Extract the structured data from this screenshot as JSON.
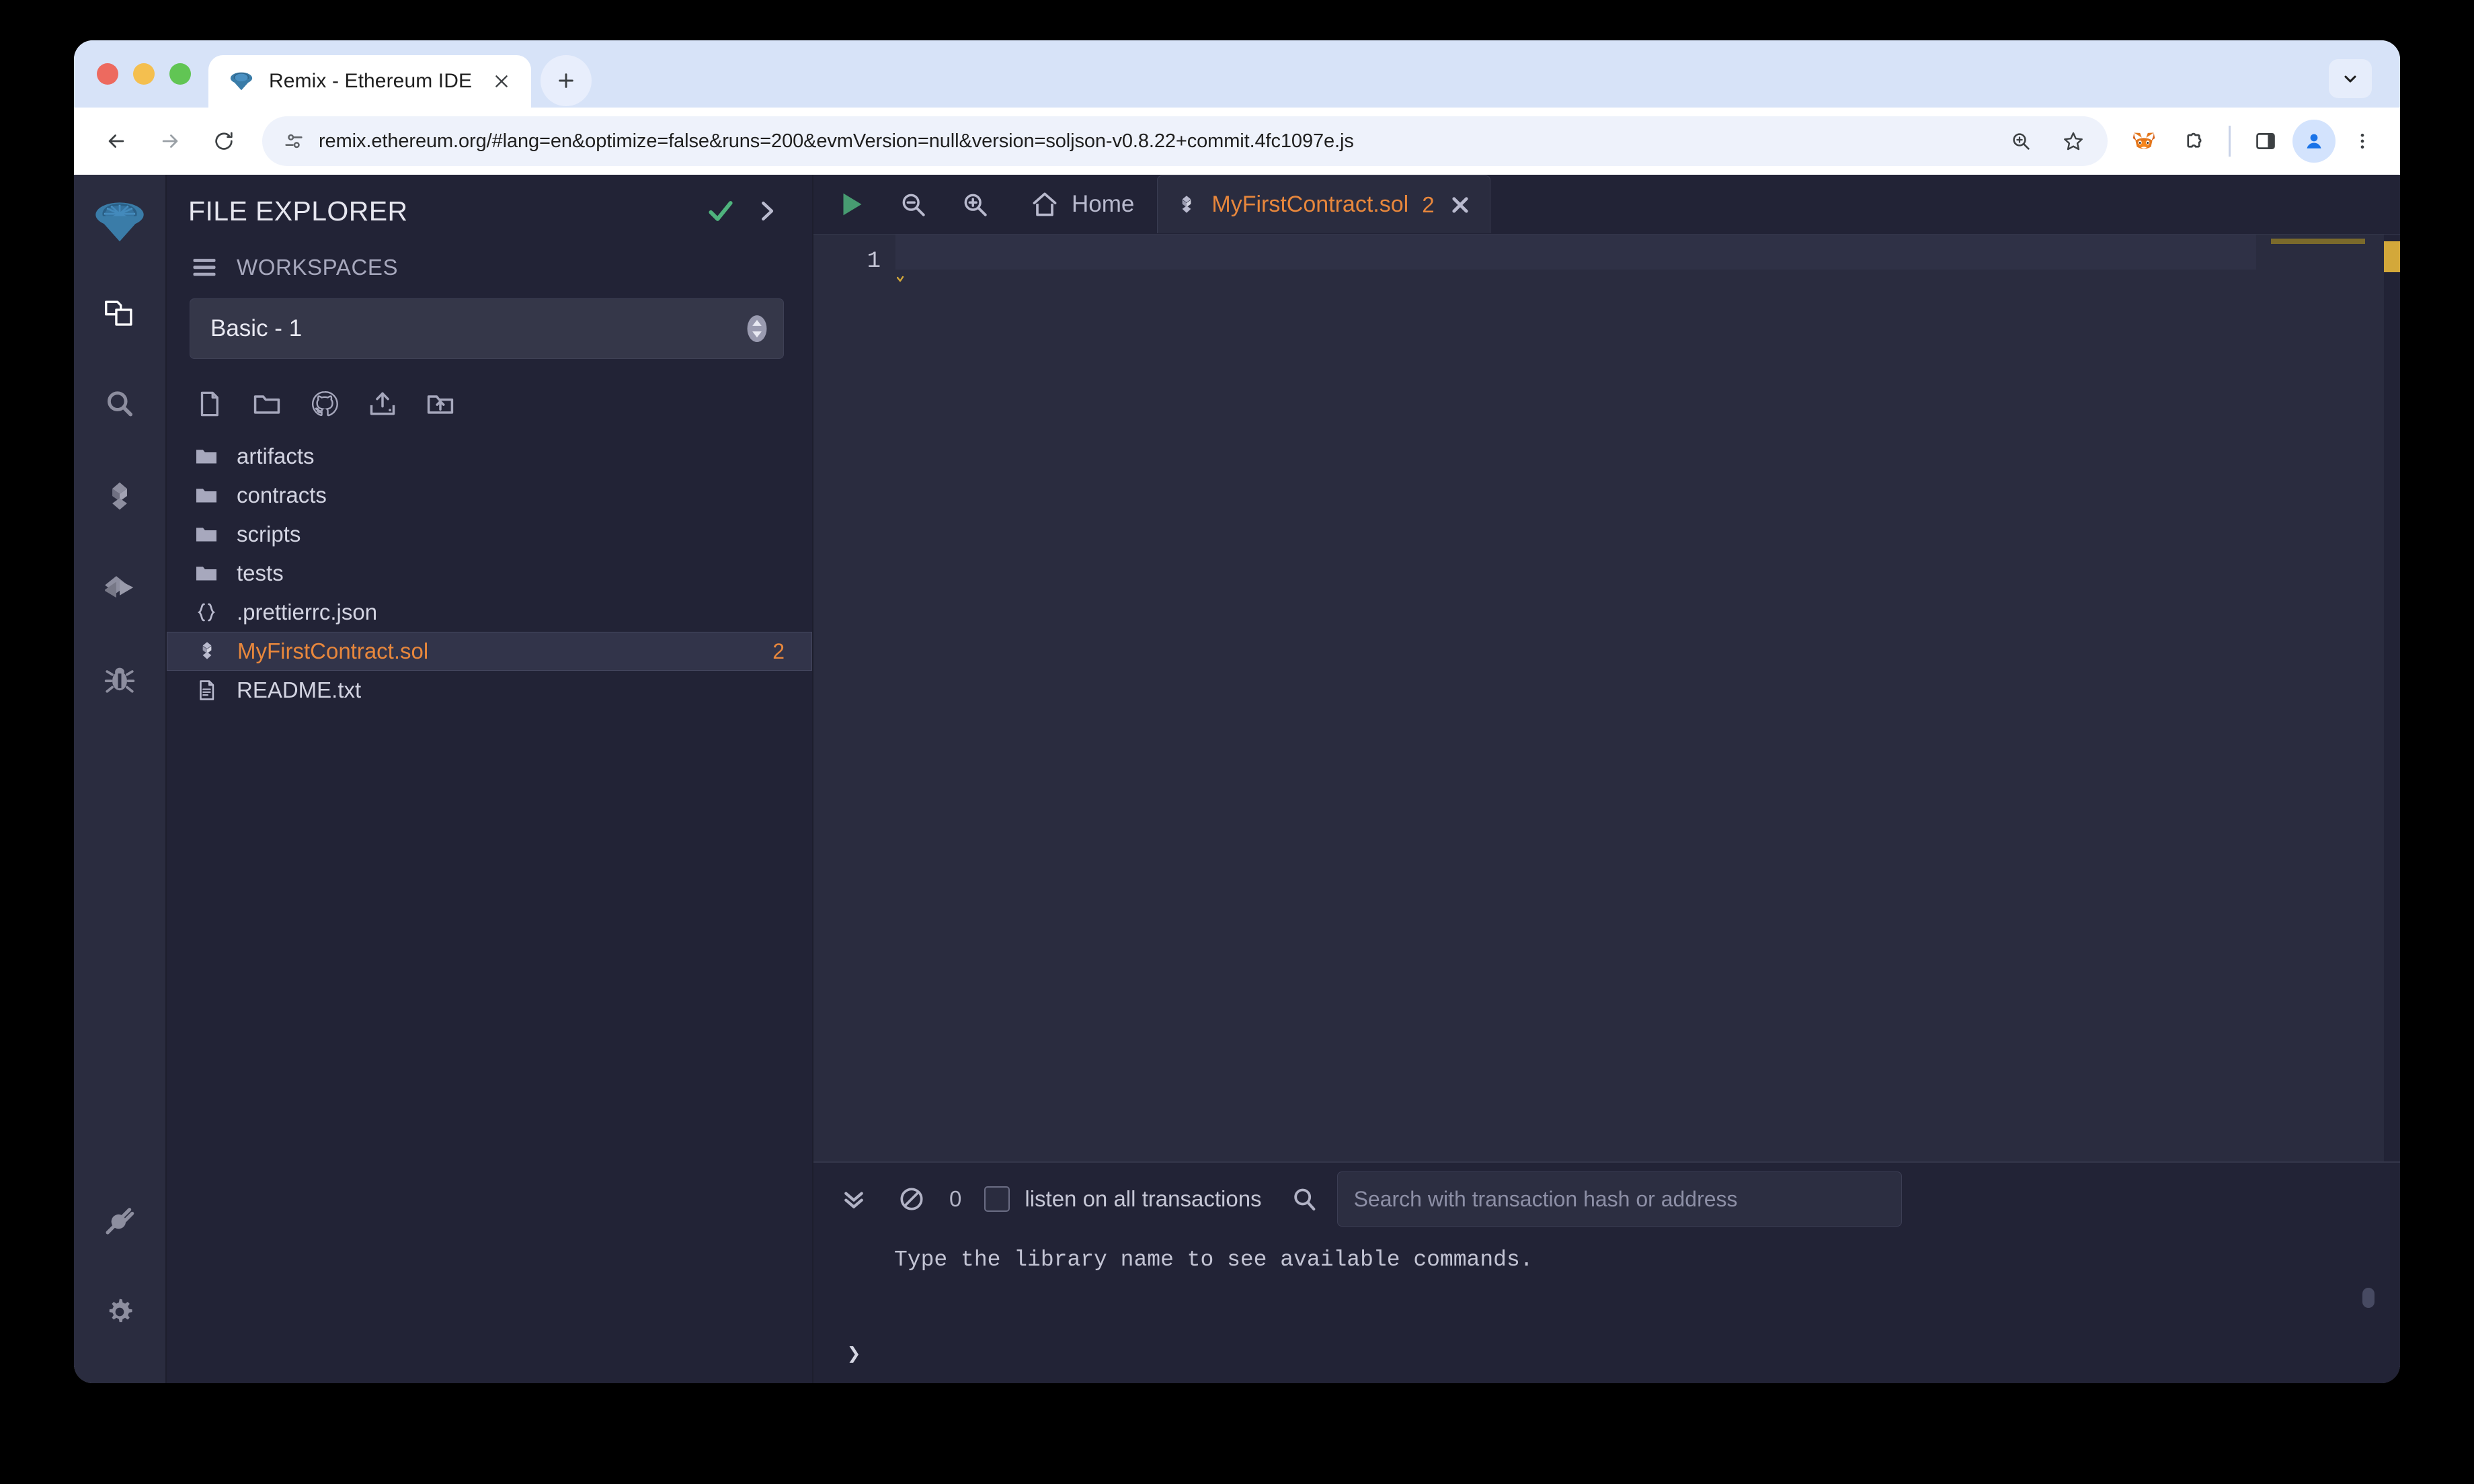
{
  "browser": {
    "tab": {
      "title": "Remix - Ethereum IDE",
      "favicon_name": "remix-logo-icon",
      "close_label": "×"
    },
    "new_tab_label": "+",
    "tab_list_label": "⌄",
    "nav": {
      "back_label": "←",
      "forward_label": "→",
      "reload_label": "↻"
    },
    "omnibox": {
      "url": "remix.ethereum.org/#lang=en&optimize=false&runs=200&evmVersion=null&version=soljson-v0.8.22+commit.4fc1097e.js",
      "site_info_icon": "page-settings-icon",
      "zoom_icon": "zoom-in-icon",
      "bookmark_icon": "star-icon"
    },
    "toolbar_icons": [
      {
        "name": "metamask-extension-icon",
        "label": "MetaMask"
      },
      {
        "name": "extensions-puzzle-icon",
        "label": "Extensions"
      },
      {
        "name": "side-panel-icon",
        "label": "Side panel"
      },
      {
        "name": "profile-avatar-icon",
        "label": "Profile"
      },
      {
        "name": "chrome-menu-icon",
        "label": "Customize and control"
      }
    ]
  },
  "ide": {
    "activity_bar": {
      "logo_name": "remix-logo-icon",
      "items": [
        {
          "name": "file-explorer",
          "icon": "files-icon",
          "active": true
        },
        {
          "name": "search",
          "icon": "search-icon",
          "active": false
        },
        {
          "name": "solidity-compiler",
          "icon": "solidity-icon",
          "active": false
        },
        {
          "name": "deploy-run",
          "icon": "deploy-arrow-icon",
          "active": false
        },
        {
          "name": "debugger",
          "icon": "bug-icon",
          "active": false
        }
      ],
      "bottom_items": [
        {
          "name": "plugin-manager",
          "icon": "plug-icon"
        },
        {
          "name": "settings",
          "icon": "gear-icon"
        }
      ]
    },
    "explorer": {
      "title": "FILE EXPLORER",
      "header_icons": [
        {
          "name": "checkmark-icon",
          "color": "#4fb37d"
        },
        {
          "name": "chevron-right-icon",
          "color": "#b9bace"
        }
      ],
      "workspaces_label": "WORKSPACES",
      "hamburger_icon": "hamburger-menu-icon",
      "workspace_value": "Basic - 1",
      "actions": [
        {
          "name": "create-new-file",
          "icon": "new-file-icon"
        },
        {
          "name": "create-new-folder",
          "icon": "new-folder-icon"
        },
        {
          "name": "clone-git-repository",
          "icon": "github-icon"
        },
        {
          "name": "publish-to-gist",
          "icon": "upload-gist-icon"
        },
        {
          "name": "upload-folder",
          "icon": "upload-folder-icon"
        }
      ],
      "tree": [
        {
          "label": "artifacts",
          "icon": "folder-icon",
          "type": "folder",
          "selected": false,
          "badge": ""
        },
        {
          "label": "contracts",
          "icon": "folder-icon",
          "type": "folder",
          "selected": false,
          "badge": ""
        },
        {
          "label": "scripts",
          "icon": "folder-icon",
          "type": "folder",
          "selected": false,
          "badge": ""
        },
        {
          "label": "tests",
          "icon": "folder-icon",
          "type": "folder",
          "selected": false,
          "badge": ""
        },
        {
          "label": ".prettierrc.json",
          "icon": "json-braces-icon",
          "type": "file",
          "selected": false,
          "badge": ""
        },
        {
          "label": "MyFirstContract.sol",
          "icon": "solidity-file-icon",
          "type": "file",
          "selected": true,
          "badge": "2"
        },
        {
          "label": "README.txt",
          "icon": "text-file-icon",
          "type": "file",
          "selected": false,
          "badge": ""
        }
      ]
    },
    "editor": {
      "toolbar": {
        "run_icon": "play-run-icon",
        "zoom_out_icon": "zoom-out-icon",
        "zoom_in_icon": "zoom-in-icon",
        "home_icon": "home-icon",
        "home_label": "Home"
      },
      "tab": {
        "icon": "solidity-file-icon",
        "label": "MyFirstContract.sol",
        "badge": "2",
        "close_label": "✖"
      },
      "line_numbers": [
        "1"
      ],
      "lines": [
        ""
      ],
      "has_warning_squiggle": true,
      "warning_color": "#d3a83a"
    },
    "terminal": {
      "collapse_icon": "double-chevron-down-icon",
      "clear_icon": "no-entry-clear-icon",
      "count": "0",
      "listen_checkbox_label": "listen on all transactions",
      "listen_checked": false,
      "search_icon": "search-icon",
      "search_placeholder": "Search with transaction hash or address",
      "output_lines": [
        "Type the library name to see available commands."
      ],
      "prompt": "❯"
    }
  },
  "colors": {
    "accent_orange": "#e8873c",
    "panel_bg": "#222336",
    "editor_bg": "#2a2c3f",
    "chrome_tabstrip": "#d7e3f8",
    "warning_yellow": "#d3a83a",
    "success_green": "#4fb37d"
  }
}
